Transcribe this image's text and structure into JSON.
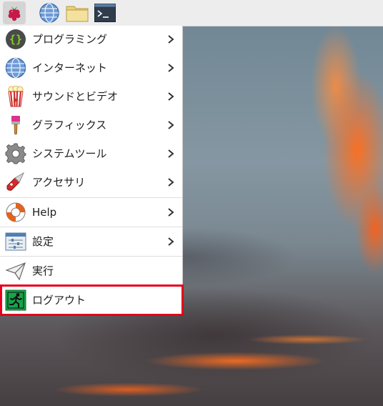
{
  "taskbar": {
    "buttons": [
      {
        "name": "raspberry-menu",
        "icon": "raspberry-icon"
      },
      {
        "name": "web-browser",
        "icon": "globe-icon"
      },
      {
        "name": "file-manager",
        "icon": "folder-icon"
      },
      {
        "name": "terminal",
        "icon": "terminal-icon"
      }
    ]
  },
  "menu": {
    "items": [
      {
        "label": "プログラミング",
        "icon": "braces-icon",
        "submenu": true
      },
      {
        "label": "インターネット",
        "icon": "globe-icon",
        "submenu": true
      },
      {
        "label": "サウンドとビデオ",
        "icon": "popcorn-icon",
        "submenu": true
      },
      {
        "label": "グラフィックス",
        "icon": "paintbrush-icon",
        "submenu": true
      },
      {
        "label": "システムツール",
        "icon": "gear-icon",
        "submenu": true
      },
      {
        "label": "アクセサリ",
        "icon": "pocket-knife-icon",
        "submenu": true
      },
      {
        "label": "Help",
        "icon": "lifebuoy-icon",
        "submenu": true
      },
      {
        "label": "設定",
        "icon": "settings-sliders-icon",
        "submenu": true
      },
      {
        "label": "実行",
        "icon": "paper-plane-icon",
        "submenu": false
      },
      {
        "label": "ログアウト",
        "icon": "exit-running-man-icon",
        "submenu": false,
        "highlighted": true
      }
    ]
  },
  "colors": {
    "highlight_border": "#e5001c",
    "exit_icon_green": "#17a34a"
  }
}
